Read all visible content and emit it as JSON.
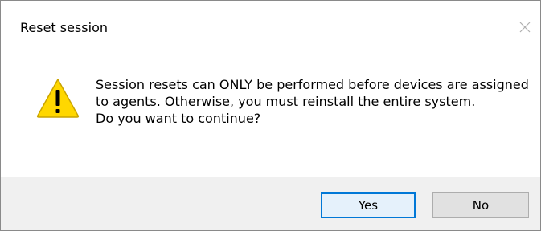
{
  "dialog": {
    "title": "Reset session",
    "close_icon": "close-icon",
    "warning_icon": "warning-icon",
    "message_lines": [
      "Session resets can ONLY be performed before devices are assigned to agents. Otherwise, you must reinstall the entire system.",
      "Do you want to continue?"
    ],
    "buttons": {
      "yes_label": "Yes",
      "no_label": "No"
    }
  },
  "colors": {
    "warning_fill": "#FFD700",
    "warning_stroke": "#C9A400",
    "default_button_border": "#0078D7",
    "footer_background": "#F0F0F0"
  }
}
